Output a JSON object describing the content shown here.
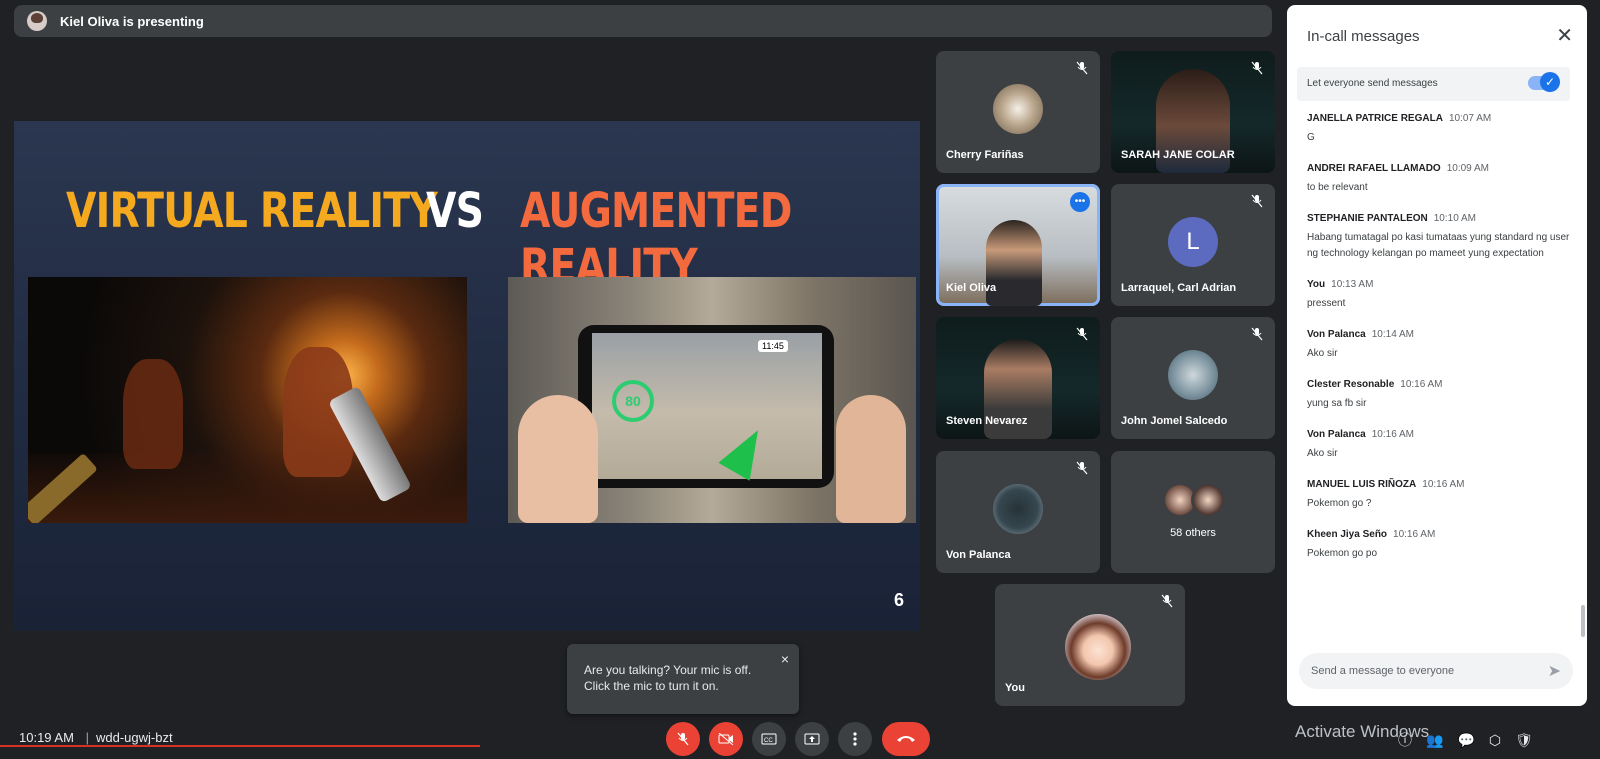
{
  "presenter_banner": "Kiel Oliva is presenting",
  "slide": {
    "left_title": "VIRTUAL REALITY",
    "vs": "VS",
    "right_title": "AUGMENTED REALITY",
    "page_number": "6",
    "ar_clock": "11:45",
    "ar_gauge": "80"
  },
  "participants": [
    {
      "name": "Cherry Fariñas"
    },
    {
      "name": "SARAH JANE COLAR"
    },
    {
      "name": "Kiel Oliva"
    },
    {
      "name": "Larraquel, Carl Adrian",
      "initial": "L"
    },
    {
      "name": "Steven Nevarez"
    },
    {
      "name": "John Jomel Salcedo"
    },
    {
      "name": "Von Palanca"
    },
    {
      "name": "58 others"
    },
    {
      "name": "You"
    }
  ],
  "toast": {
    "line1": "Are you talking? Your mic is off.",
    "line2": "Click the mic to turn it on.",
    "close": "×"
  },
  "bottom": {
    "time": "10:19 AM",
    "separator": "|",
    "meeting_code": "wdd-ugwj-bzt"
  },
  "chat": {
    "title": "In-call messages",
    "close": "✕",
    "toggle_label": "Let everyone send messages",
    "messages": [
      {
        "sender": "JANELLA PATRICE REGALA",
        "time": "10:07 AM",
        "text": "G"
      },
      {
        "sender": "ANDREI RAFAEL LLAMADO",
        "time": "10:09 AM",
        "text": "to be relevant"
      },
      {
        "sender": "STEPHANIE PANTALEON",
        "time": "10:10 AM",
        "text": "Habang tumatagal po kasi tumataas yung standard ng user ng technology kelangan po mameet yung expectation"
      },
      {
        "sender": "You",
        "time": "10:13 AM",
        "text": "pressent"
      },
      {
        "sender": "Von Palanca",
        "time": "10:14 AM",
        "text": "Ako sir"
      },
      {
        "sender": "Clester Resonable",
        "time": "10:16 AM",
        "text": "yung sa fb sir"
      },
      {
        "sender": "Von Palanca",
        "time": "10:16 AM",
        "text": "Ako sir"
      },
      {
        "sender": "MANUEL LUIS RIÑOZA",
        "time": "10:16 AM",
        "text": "Pokemon go ?"
      },
      {
        "sender": "Kheen Jiya Seño",
        "time": "10:16 AM",
        "text": "Pokemon go po"
      }
    ],
    "input_placeholder": "Send a message to everyone"
  },
  "activate_windows": "Activate Windows",
  "colors": {
    "background": "#202124",
    "tile": "#3c4043",
    "accent_blue": "#1a73e8",
    "danger_red": "#ea4335",
    "vr_title": "#f5a91f",
    "ar_title": "#f26a3e"
  }
}
